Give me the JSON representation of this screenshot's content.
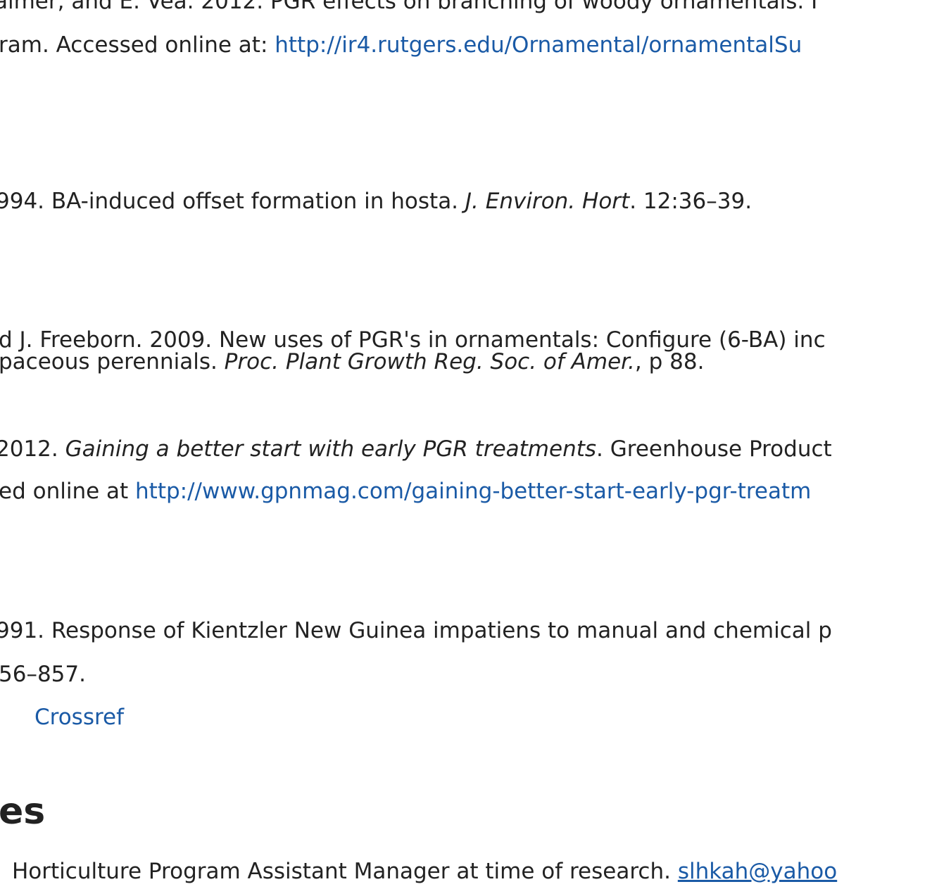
{
  "references": {
    "ref1": {
      "line1": "almer, and E. Vea. 2012. PGR effects on branching of woody ornamentals. I",
      "line2_prefix": "ram. Accessed online at:  ",
      "line2_link": "http://ir4.rutgers.edu/Ornamental/ornamentalSu"
    },
    "ref2": {
      "prefix": "994. BA-induced offset formation in hosta. ",
      "journal": "J. Environ. Hort",
      "suffix": ". 12:36–39."
    },
    "ref3": {
      "line1": "d J. Freeborn. 2009. New uses of PGR's in ornamentals: Configure (6-BA) inc",
      "line2_prefix": "paceous perennials. ",
      "line2_journal": "Proc. Plant Growth Reg. Soc. of Amer.",
      "line2_suffix": ", p 88."
    },
    "ref4": {
      "line1_prefix": "2012. ",
      "line1_title": "Gaining a better start with early PGR treatments",
      "line1_suffix": ". Greenhouse Product",
      "line2_prefix": "ed online at  ",
      "line2_link": "http://www.gpnmag.com/gaining-better-start-early-pgr-treatm"
    },
    "ref5": {
      "line1": "991. Response of Kientzler New Guinea impatiens to manual and chemical p",
      "line2": "56–857.",
      "crossref_label": "Crossref"
    }
  },
  "notes": {
    "heading": "es",
    "line_prefix": "Horticulture Program Assistant Manager at time of research. ",
    "email_link": "slhkah@yahoo"
  },
  "colors": {
    "text": "#222222",
    "link": "#1a5aa6",
    "background": "#ffffff"
  }
}
